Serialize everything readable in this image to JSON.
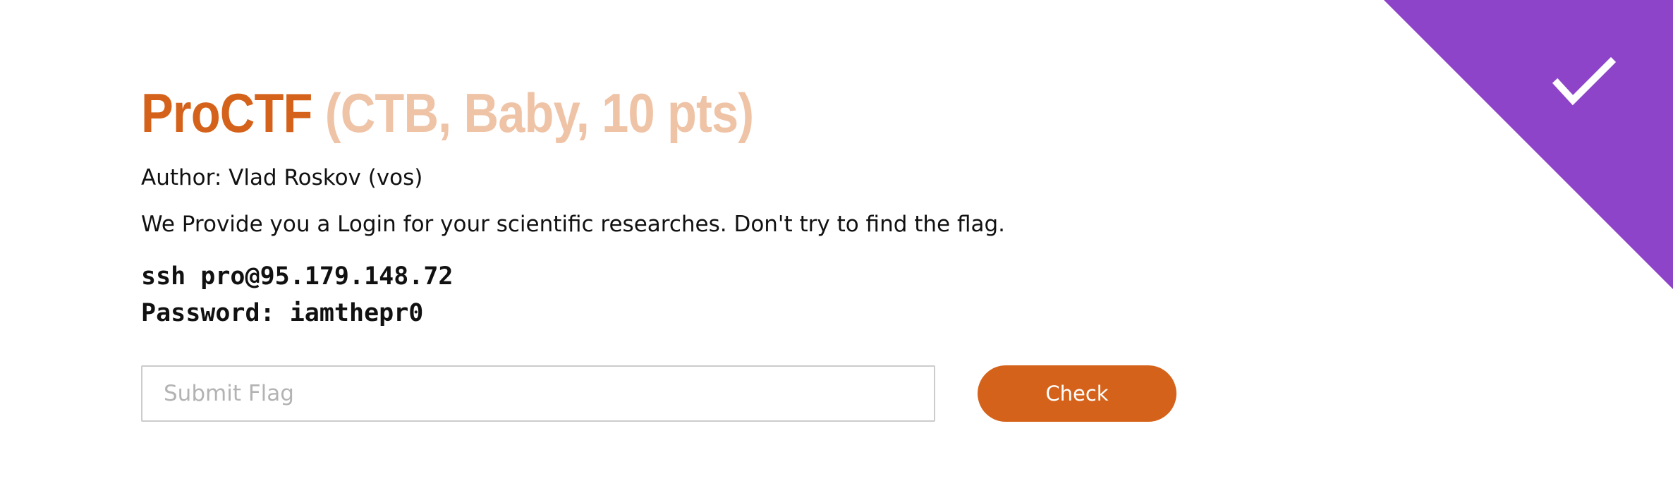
{
  "task": {
    "name": "ProCTF",
    "meta": "(CTB, Baby, 10 pts)",
    "author": "Author: Vlad Roskov (vos)",
    "description": "We Provide you a Login for your scientific researches. Don't try to find the flag.",
    "code_line1": "ssh pro@95.179.148.72",
    "code_line2": "Password: iamthepr0",
    "solved": true
  },
  "form": {
    "placeholder": "Submit Flag",
    "value": "",
    "button_label": "Check"
  },
  "colors": {
    "accent": "#d5621a",
    "accent_light": "#efc3a6",
    "solved_ribbon": "#8e44c8"
  },
  "icons": {
    "solved_badge": "checkmark-icon"
  }
}
